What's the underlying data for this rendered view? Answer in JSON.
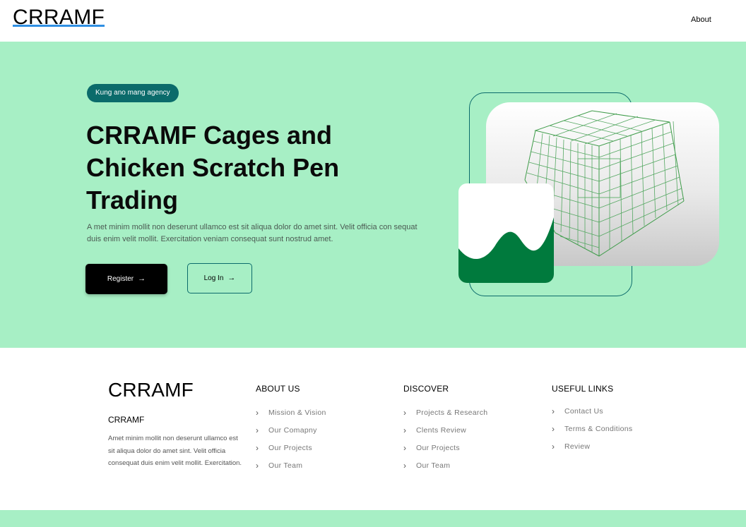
{
  "header": {
    "logo": "CRRAMF",
    "nav_about": "About"
  },
  "hero": {
    "badge": "Kung ano mang agency",
    "title": "CRRAMF Cages and Chicken Scratch Pen Trading",
    "description": "A met minim mollit non deserunt ullamco est sit aliqua dolor do amet sint. Velit officia con sequat duis enim velit mollit. Exercitation veniam consequat sunt nostrud amet.",
    "register_label": "Register",
    "login_label": "Log In",
    "arrow_icon": "arrow-right-icon",
    "colors": {
      "background": "#a7efc5",
      "accent": "#0b6b6b",
      "wave": "#007a3d"
    }
  },
  "footer": {
    "logo": "CRRAMF",
    "subtitle": "CRRAMF",
    "description": "Amet minim mollit non deserunt ullamco est sit aliqua dolor do amet sint. Velit officia consequat duis enim velit mollit. Exercitation.",
    "about_us": {
      "heading": "ABOUT US",
      "items": [
        "Mission & Vision",
        "Our Comapny",
        "Our Projects",
        "Our Team"
      ]
    },
    "discover": {
      "heading": "DISCOVER",
      "items": [
        "Projects & Research",
        "Clents Review",
        "Our Projects",
        "Our Team"
      ]
    },
    "useful_links": {
      "heading": "USEFUL LINKS",
      "items": [
        "Contact Us",
        "Terms & Conditions",
        "Review"
      ]
    }
  }
}
